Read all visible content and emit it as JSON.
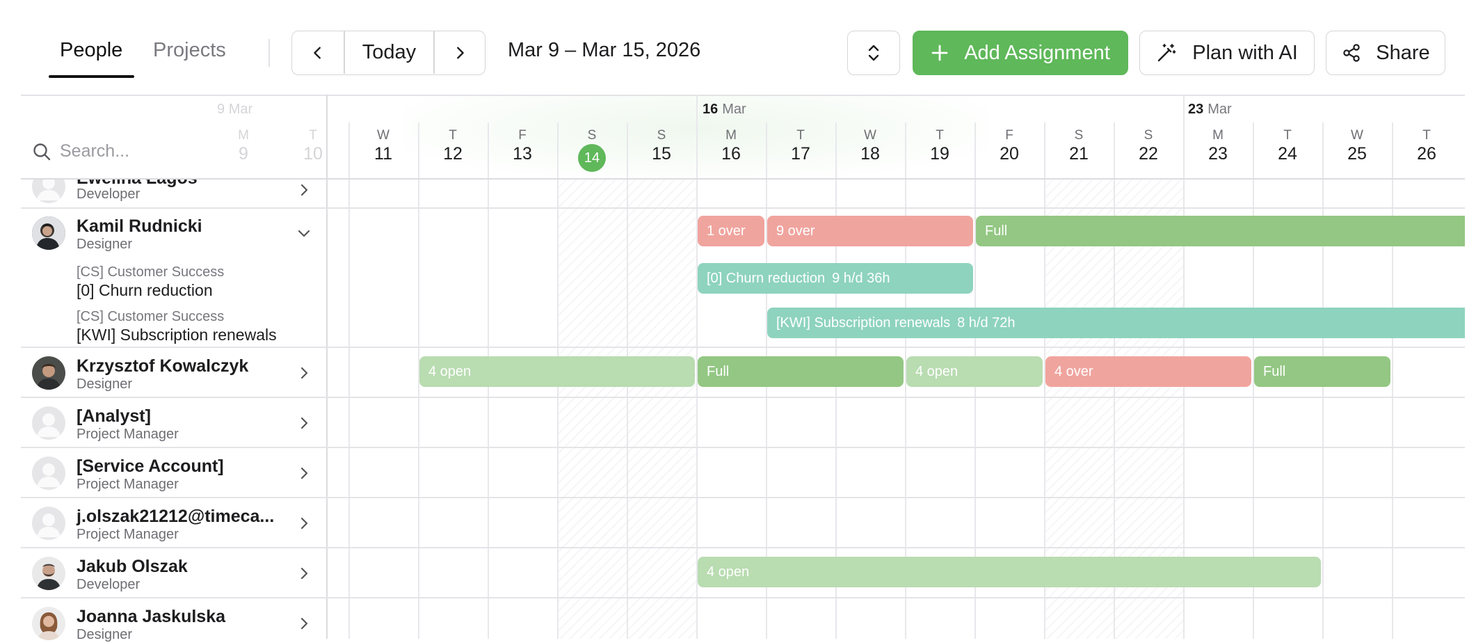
{
  "tabs": [
    {
      "label": "People",
      "active": true
    },
    {
      "label": "Projects",
      "active": false
    }
  ],
  "toolbar": {
    "prev_icon": "chevron-left-icon",
    "today_label": "Today",
    "next_icon": "chevron-right-icon",
    "date_range": "Mar 9 – Mar 15, 2026",
    "expand_icon": "chevron-up-down-icon",
    "add_assignment_label": "Add Assignment",
    "plan_ai_label": "Plan with AI",
    "share_label": "Share"
  },
  "search": {
    "placeholder": "Search..."
  },
  "calendar": {
    "ghost_week": {
      "day": "9",
      "month": "Mar",
      "dows": [
        "M",
        "T"
      ],
      "nums": [
        "9",
        "10"
      ]
    },
    "weeks": [
      {
        "day": "16",
        "month": "Mar"
      },
      {
        "day": "23",
        "month": "Mar"
      }
    ],
    "days": [
      {
        "dow": "W",
        "num": "11"
      },
      {
        "dow": "T",
        "num": "12"
      },
      {
        "dow": "F",
        "num": "13"
      },
      {
        "dow": "S",
        "num": "14",
        "today": true
      },
      {
        "dow": "S",
        "num": "15"
      },
      {
        "dow": "M",
        "num": "16"
      },
      {
        "dow": "T",
        "num": "17"
      },
      {
        "dow": "W",
        "num": "18"
      },
      {
        "dow": "T",
        "num": "19"
      },
      {
        "dow": "F",
        "num": "20"
      },
      {
        "dow": "S",
        "num": "21"
      },
      {
        "dow": "S",
        "num": "22"
      },
      {
        "dow": "M",
        "num": "23"
      },
      {
        "dow": "T",
        "num": "24"
      },
      {
        "dow": "W",
        "num": "25"
      },
      {
        "dow": "T",
        "num": "26"
      }
    ]
  },
  "people": [
    {
      "name": "Ewelina Łagos",
      "role": "Developer"
    },
    {
      "name": "Kamil Rudnicki",
      "role": "Designer",
      "assignments": [
        {
          "client": "[CS] Customer Success",
          "project": "[0] Churn reduction"
        },
        {
          "client": "[CS] Customer Success",
          "project": "[KWI] Subscription renewals"
        }
      ]
    },
    {
      "name": "Krzysztof Kowalczyk",
      "role": "Designer"
    },
    {
      "name": "[Analyst]",
      "role": "Project Manager"
    },
    {
      "name": "[Service Account]",
      "role": "Project Manager"
    },
    {
      "name": "j.olszak21212@timeca...",
      "role": "Project Manager"
    },
    {
      "name": "Jakub Olszak",
      "role": "Developer"
    },
    {
      "name": "Joanna Jaskulska",
      "role": "Designer"
    }
  ],
  "bars": {
    "kamil": [
      {
        "label": "1 over",
        "status": "over"
      },
      {
        "label": "9 over",
        "status": "over"
      },
      {
        "label": "Full",
        "status": "full"
      }
    ],
    "churn": {
      "label": "[0] Churn reduction",
      "detail": "9 h/d 36h"
    },
    "renewals": {
      "label": "[KWI] Subscription renewals",
      "detail": "8 h/d 72h"
    },
    "krzysztof": [
      {
        "label": "4 open",
        "status": "open"
      },
      {
        "label": "Full",
        "status": "full"
      },
      {
        "label": "4 open",
        "status": "open"
      },
      {
        "label": "4 over",
        "status": "over"
      },
      {
        "label": "Full",
        "status": "full"
      }
    ],
    "jakub": [
      {
        "label": "4 open",
        "status": "open"
      }
    ]
  },
  "colors": {
    "accent": "#5fb85a",
    "full": "#93c783",
    "open": "#b9dcb1",
    "over": "#f0a49e",
    "project": "#8ed3be"
  }
}
